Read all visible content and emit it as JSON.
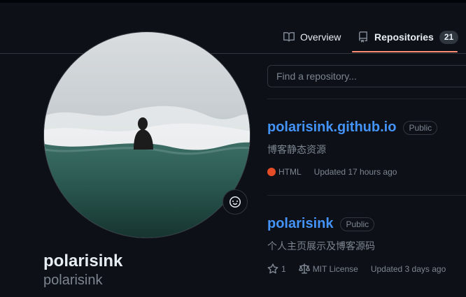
{
  "profile": {
    "name": "polarisink",
    "login": "polarisink"
  },
  "tabs": [
    {
      "label": "Overview"
    },
    {
      "label": "Repositories",
      "count": "21"
    }
  ],
  "search": {
    "placeholder": "Find a repository..."
  },
  "repos": [
    {
      "name": "polarisink.github.io",
      "visibility": "Public",
      "description": "博客静态资源",
      "language": "HTML",
      "language_color": "#e34c26",
      "updated": "Updated 17 hours ago"
    },
    {
      "name": "polarisink",
      "visibility": "Public",
      "description": "个人主页展示及博客源码",
      "stars": "1",
      "license": "MIT License",
      "updated": "Updated 3 days ago"
    }
  ],
  "colors": {
    "background": "#0d1117",
    "link": "#4493f8",
    "muted": "#7d8590",
    "tab_underline": "#fd8c73"
  },
  "icons": [
    "book-icon",
    "repo-icon",
    "smiley-icon",
    "star-icon",
    "law-icon"
  ]
}
